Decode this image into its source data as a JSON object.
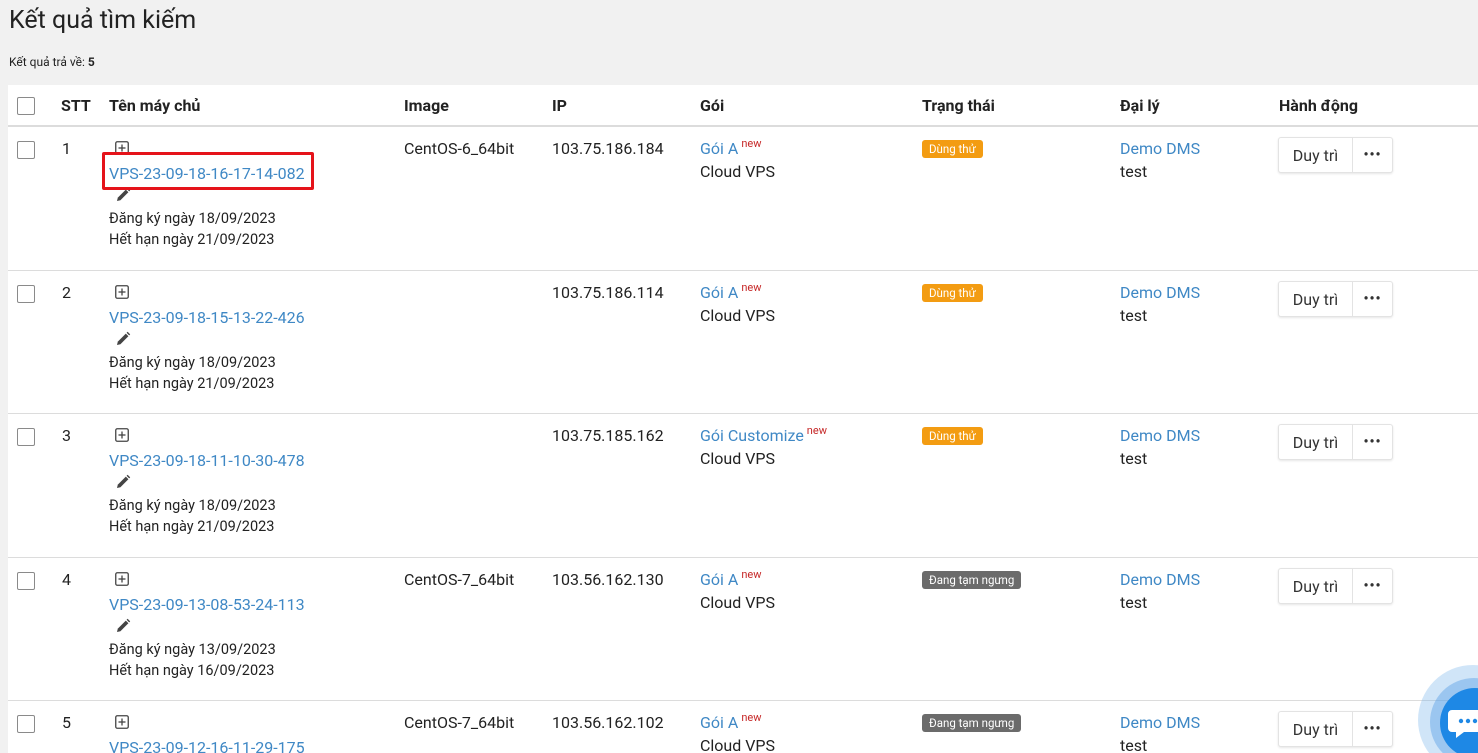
{
  "page": {
    "title": "Kết quả tìm kiếm",
    "result_label": "Kết quả trả về:",
    "result_count": "5"
  },
  "table": {
    "headers": {
      "stt": "STT",
      "name": "Tên máy chủ",
      "image": "Image",
      "ip": "IP",
      "plan": "Gói",
      "status": "Trạng thái",
      "agent": "Đại lý",
      "action": "Hành động"
    },
    "rows": [
      {
        "stt": "1",
        "name": "VPS-23-09-18-16-17-14-082",
        "registered": "Đăng ký ngày 18/09/2023",
        "expires": "Hết hạn ngày 21/09/2023",
        "image": "CentOS-6_64bit",
        "ip": "103.75.186.184",
        "plan": "Gói A",
        "plan_tag": "new",
        "plan_type": "Cloud VPS",
        "status": "Dùng thử",
        "status_kind": "trial",
        "agent": "Demo DMS",
        "agent_user": "test",
        "action": "Duy trì",
        "more": "•••"
      },
      {
        "stt": "2",
        "name": "VPS-23-09-18-15-13-22-426",
        "registered": "Đăng ký ngày 18/09/2023",
        "expires": "Hết hạn ngày 21/09/2023",
        "image": "",
        "ip": "103.75.186.114",
        "plan": "Gói A",
        "plan_tag": "new",
        "plan_type": "Cloud VPS",
        "status": "Dùng thử",
        "status_kind": "trial",
        "agent": "Demo DMS",
        "agent_user": "test",
        "action": "Duy trì",
        "more": "•••"
      },
      {
        "stt": "3",
        "name": "VPS-23-09-18-11-10-30-478",
        "registered": "Đăng ký ngày 18/09/2023",
        "expires": "Hết hạn ngày 21/09/2023",
        "image": "",
        "ip": "103.75.185.162",
        "plan": "Gói Customize",
        "plan_tag": "new",
        "plan_type": "Cloud VPS",
        "status": "Dùng thử",
        "status_kind": "trial",
        "agent": "Demo DMS",
        "agent_user": "test",
        "action": "Duy trì",
        "more": "•••"
      },
      {
        "stt": "4",
        "name": "VPS-23-09-13-08-53-24-113",
        "registered": "Đăng ký ngày 13/09/2023",
        "expires": "Hết hạn ngày 16/09/2023",
        "image": "CentOS-7_64bit",
        "ip": "103.56.162.130",
        "plan": "Gói A",
        "plan_tag": "new",
        "plan_type": "Cloud VPS",
        "status": "Đang tạm ngưng",
        "status_kind": "paused",
        "agent": "Demo DMS",
        "agent_user": "test",
        "action": "Duy trì",
        "more": "•••"
      },
      {
        "stt": "5",
        "name": "VPS-23-09-12-16-11-29-175",
        "registered": "",
        "expires": "",
        "image": "CentOS-7_64bit",
        "ip": "103.56.162.102",
        "plan": "Gói A",
        "plan_tag": "new",
        "plan_type": "Cloud VPS",
        "status": "Đang tạm ngưng",
        "status_kind": "paused",
        "agent": "Demo DMS",
        "agent_user": "test",
        "action": "Duy trì",
        "more": "•••"
      }
    ]
  },
  "colors": {
    "link": "#3f88c5",
    "trial_badge": "#f39c12",
    "paused_badge": "#6b6b6b",
    "highlight": "#e5131a",
    "chat": "#1e88e5"
  },
  "icons": {
    "expand": "plus-square-icon",
    "edit": "pencil-icon",
    "chat": "chat-bubble-icon"
  }
}
